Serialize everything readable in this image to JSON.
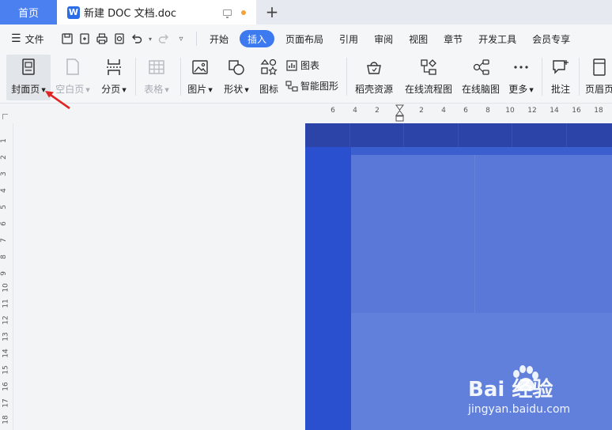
{
  "tabs": {
    "home_label": "首页",
    "doc_logo": "W",
    "doc_title": "新建 DOC 文档.doc",
    "add_label": "+"
  },
  "menu": {
    "file_label": "文件",
    "tabs": [
      "开始",
      "插入",
      "页面布局",
      "引用",
      "审阅",
      "视图",
      "章节",
      "开发工具",
      "会员专享"
    ],
    "active_tab": "插入"
  },
  "ribbon": {
    "cover_page": "封面页",
    "blank_page": "空白页",
    "page_break": "分页",
    "table": "表格",
    "picture": "图片",
    "shape": "形状",
    "icon": "图标",
    "chart": "图表",
    "smart_art": "智能图形",
    "daoke_resource": "稻壳资源",
    "online_flowchart": "在线流程图",
    "online_mindmap": "在线脑图",
    "more": "更多",
    "comment": "批注",
    "header_footer": "页眉页"
  },
  "ruler": {
    "h_ticks": [
      "6",
      "4",
      "2",
      "2",
      "4",
      "6",
      "8",
      "10",
      "12",
      "14",
      "16",
      "18"
    ],
    "v_ticks": [
      "1",
      "2",
      "3",
      "4",
      "5",
      "6",
      "7",
      "8",
      "9",
      "10",
      "11",
      "12",
      "13",
      "14",
      "15",
      "16",
      "17",
      "18"
    ]
  },
  "watermark": {
    "brand": "Bai 经验",
    "url": "jingyan.baidu.com"
  },
  "colors": {
    "accent": "#3d7af0",
    "home_tab": "#4b80f0",
    "cover_blue": "#2a4fcf",
    "annotation_red": "#e02424"
  }
}
